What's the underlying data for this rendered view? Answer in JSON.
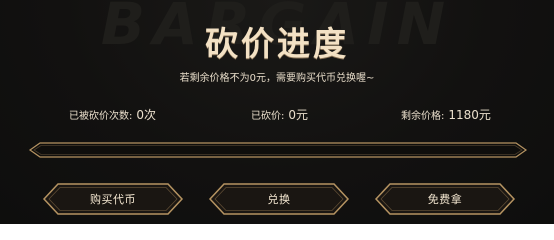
{
  "watermark": "BARGAIN",
  "title": "砍价进度",
  "subtitle": "若剩余价格不为0元，需要购买代币兑换喔~",
  "stats": {
    "count_label": "已被砍价次数:",
    "count_value": "0次",
    "cut_label": "已砍价:",
    "cut_value": "0元",
    "remain_label": "剩余价格:",
    "remain_value": "1180元"
  },
  "progress": {
    "fraction": 0
  },
  "buttons": {
    "buy_label": "购买代币",
    "exchange_label": "兑换",
    "free_label": "免费拿"
  },
  "colors": {
    "gold": "#b69462",
    "text_light": "#eadfcc",
    "background": "#121110"
  }
}
